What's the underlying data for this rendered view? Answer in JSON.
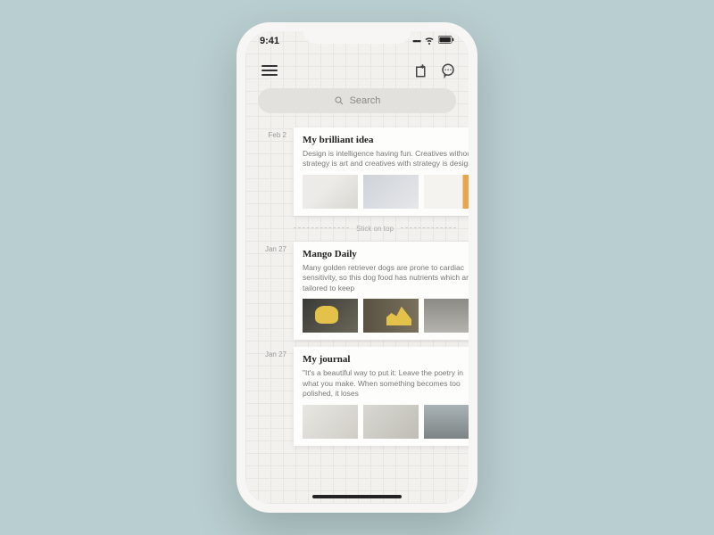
{
  "status": {
    "time": "9:41"
  },
  "search": {
    "placeholder": "Search"
  },
  "divider_label": "Stick on top",
  "entries": [
    {
      "date": "Feb 2",
      "title": "My brilliant idea",
      "body": "Design is intelligence having fun. Creatives without strategy is art and creatives with strategy is design."
    },
    {
      "date": "Jan 27",
      "title": "Mango Daily",
      "body": "Many golden retriever dogs are prone to cardiac sensitivity, so this dog food has nutrients which are tailored to keep"
    },
    {
      "date": "Jan 27",
      "title": "My journal",
      "body": "\"It's a beautiful way to put it: Leave the poetry in what you make. When something becomes too polished, it loses"
    }
  ]
}
